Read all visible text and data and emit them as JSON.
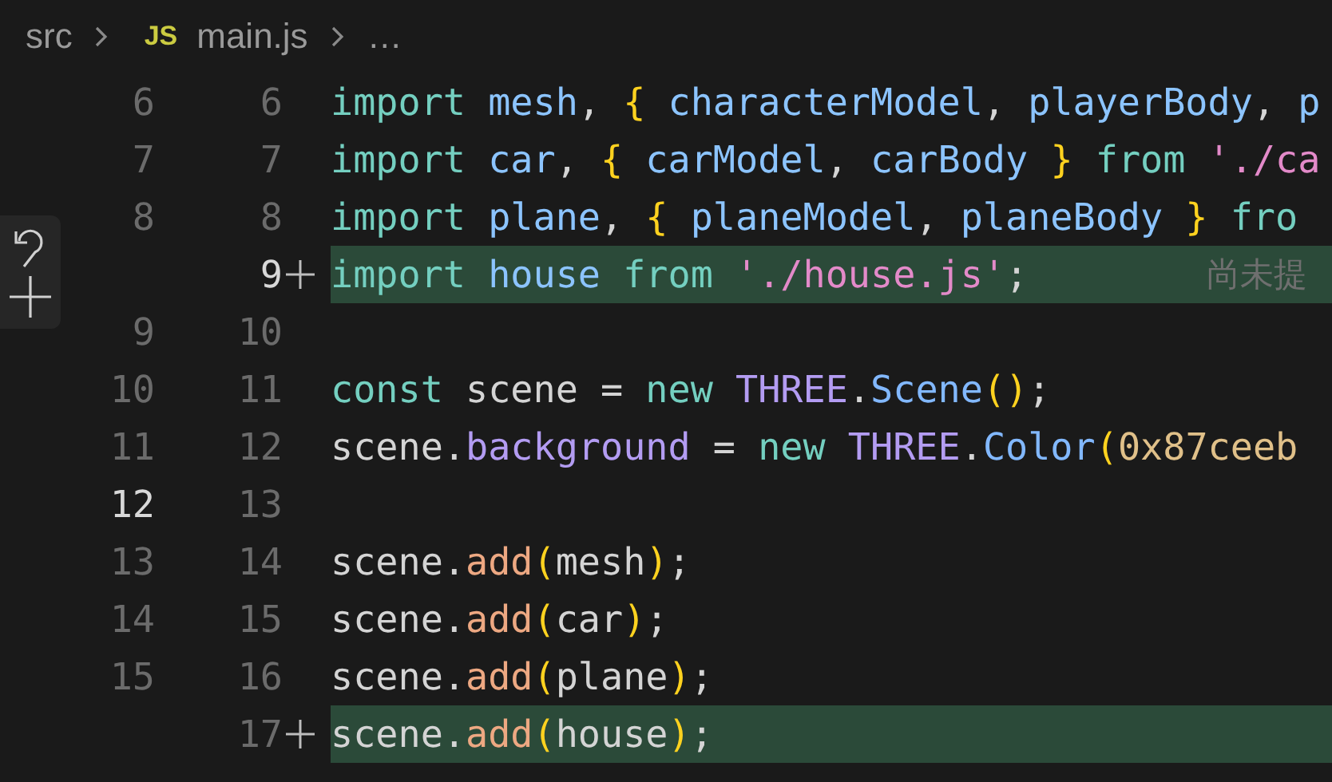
{
  "breadcrumb": [
    {
      "kind": "folder",
      "text": "src"
    },
    {
      "kind": "file",
      "badge": "JS",
      "text": "main.js"
    },
    {
      "kind": "more",
      "text": "…"
    }
  ],
  "rows": [
    {
      "old": {
        "text": "6",
        "active": false
      },
      "new": {
        "text": "6",
        "active": false
      },
      "added": false,
      "tokens": [
        {
          "kind": "keyword",
          "text": "import "
        },
        {
          "kind": "variable",
          "text": "mesh"
        },
        {
          "kind": "plain",
          "text": ", "
        },
        {
          "kind": "brace",
          "text": "{ "
        },
        {
          "kind": "variable",
          "text": "characterModel"
        },
        {
          "kind": "plain",
          "text": ", "
        },
        {
          "kind": "variable",
          "text": "playerBody"
        },
        {
          "kind": "plain",
          "text": ", "
        },
        {
          "kind": "variable",
          "text": "p"
        }
      ]
    },
    {
      "old": {
        "text": "7",
        "active": false
      },
      "new": {
        "text": "7",
        "active": false
      },
      "added": false,
      "tokens": [
        {
          "kind": "keyword",
          "text": "import "
        },
        {
          "kind": "variable",
          "text": "car"
        },
        {
          "kind": "plain",
          "text": ", "
        },
        {
          "kind": "brace",
          "text": "{ "
        },
        {
          "kind": "variable",
          "text": "carModel"
        },
        {
          "kind": "plain",
          "text": ", "
        },
        {
          "kind": "variable",
          "text": "carBody "
        },
        {
          "kind": "brace",
          "text": "} "
        },
        {
          "kind": "keyword",
          "text": "from "
        },
        {
          "kind": "string",
          "text": "'./ca"
        }
      ]
    },
    {
      "old": {
        "text": "8",
        "active": false
      },
      "new": {
        "text": "8",
        "active": false
      },
      "added": false,
      "tokens": [
        {
          "kind": "keyword",
          "text": "import "
        },
        {
          "kind": "variable",
          "text": "plane"
        },
        {
          "kind": "plain",
          "text": ", "
        },
        {
          "kind": "brace",
          "text": "{ "
        },
        {
          "kind": "variable",
          "text": "planeModel"
        },
        {
          "kind": "plain",
          "text": ", "
        },
        {
          "kind": "variable",
          "text": "planeBody "
        },
        {
          "kind": "brace",
          "text": "} "
        },
        {
          "kind": "keyword",
          "text": "fro"
        }
      ]
    },
    {
      "new": {
        "text": "9",
        "active": true
      },
      "added": true,
      "hint": "尚未提",
      "tokens": [
        {
          "kind": "keyword",
          "text": "import "
        },
        {
          "kind": "variable",
          "text": "house "
        },
        {
          "kind": "keyword",
          "text": "from "
        },
        {
          "kind": "string",
          "text": "'./house.js'"
        },
        {
          "kind": "plain",
          "text": ";"
        }
      ]
    },
    {
      "old": {
        "text": "9",
        "active": false
      },
      "new": {
        "text": "10",
        "active": false
      },
      "added": false,
      "tokens": []
    },
    {
      "old": {
        "text": "10",
        "active": false
      },
      "new": {
        "text": "11",
        "active": false
      },
      "added": false,
      "tokens": [
        {
          "kind": "keyword",
          "text": "const "
        },
        {
          "kind": "plain",
          "text": "scene = "
        },
        {
          "kind": "keyword",
          "text": "new "
        },
        {
          "kind": "class",
          "text": "THREE"
        },
        {
          "kind": "plain",
          "text": "."
        },
        {
          "kind": "function",
          "text": "Scene"
        },
        {
          "kind": "brace",
          "text": "()"
        },
        {
          "kind": "plain",
          "text": ";"
        }
      ]
    },
    {
      "old": {
        "text": "11",
        "active": false
      },
      "new": {
        "text": "12",
        "active": false
      },
      "added": false,
      "tokens": [
        {
          "kind": "plain",
          "text": "scene."
        },
        {
          "kind": "property",
          "text": "background"
        },
        {
          "kind": "plain",
          "text": " = "
        },
        {
          "kind": "keyword",
          "text": "new "
        },
        {
          "kind": "class",
          "text": "THREE"
        },
        {
          "kind": "plain",
          "text": "."
        },
        {
          "kind": "function",
          "text": "Color"
        },
        {
          "kind": "brace",
          "text": "("
        },
        {
          "kind": "number",
          "text": "0x87ceeb"
        }
      ]
    },
    {
      "old": {
        "text": "12",
        "active": true
      },
      "new": {
        "text": "13",
        "active": false
      },
      "added": false,
      "tokens": []
    },
    {
      "old": {
        "text": "13",
        "active": false
      },
      "new": {
        "text": "14",
        "active": false
      },
      "added": false,
      "tokens": [
        {
          "kind": "plain",
          "text": "scene."
        },
        {
          "kind": "method",
          "text": "add"
        },
        {
          "kind": "brace",
          "text": "("
        },
        {
          "kind": "plain",
          "text": "mesh"
        },
        {
          "kind": "brace",
          "text": ")"
        },
        {
          "kind": "plain",
          "text": ";"
        }
      ]
    },
    {
      "old": {
        "text": "14",
        "active": false
      },
      "new": {
        "text": "15",
        "active": false
      },
      "added": false,
      "tokens": [
        {
          "kind": "plain",
          "text": "scene."
        },
        {
          "kind": "method",
          "text": "add"
        },
        {
          "kind": "brace",
          "text": "("
        },
        {
          "kind": "plain",
          "text": "car"
        },
        {
          "kind": "brace",
          "text": ")"
        },
        {
          "kind": "plain",
          "text": ";"
        }
      ]
    },
    {
      "old": {
        "text": "15",
        "active": false
      },
      "new": {
        "text": "16",
        "active": false
      },
      "added": false,
      "tokens": [
        {
          "kind": "plain",
          "text": "scene."
        },
        {
          "kind": "method",
          "text": "add"
        },
        {
          "kind": "brace",
          "text": "("
        },
        {
          "kind": "plain",
          "text": "plane"
        },
        {
          "kind": "brace",
          "text": ")"
        },
        {
          "kind": "plain",
          "text": ";"
        }
      ]
    },
    {
      "new": {
        "text": "17",
        "active": false
      },
      "added": true,
      "tokens": [
        {
          "kind": "plain",
          "text": "scene."
        },
        {
          "kind": "method",
          "text": "add"
        },
        {
          "kind": "brace",
          "text": "("
        },
        {
          "kind": "plain",
          "text": "house"
        },
        {
          "kind": "brace",
          "text": ")"
        },
        {
          "kind": "plain",
          "text": ";"
        }
      ]
    }
  ]
}
